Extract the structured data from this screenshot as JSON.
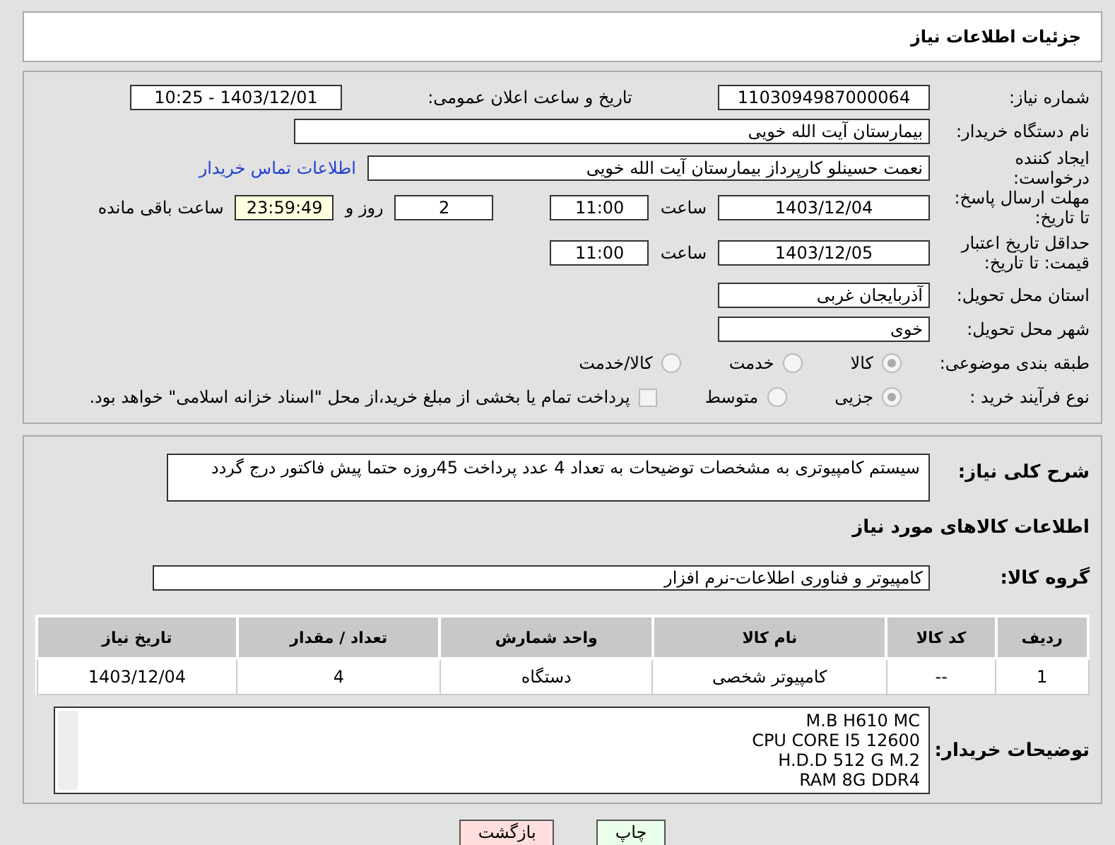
{
  "header": {
    "title": "جزئیات اطلاعات نیاز"
  },
  "need_number": {
    "label": "شماره نیاز:",
    "value": "1103094987000064"
  },
  "announce": {
    "label": "تاریخ و ساعت اعلان عمومی:",
    "value": "1403/12/01 - 10:25"
  },
  "buyer": {
    "label": "نام دستگاه خریدار:",
    "value": "بیمارستان آیت الله خویی"
  },
  "creator": {
    "label": "ایجاد کننده درخواست:",
    "value": "نعمت حسینلو کارپرداز بیمارستان آیت الله خویی",
    "link": "اطلاعات تماس خریدار"
  },
  "deadline": {
    "label": "مهلت ارسال پاسخ: تا تاریخ:",
    "date": "1403/12/04",
    "time_label": "ساعت",
    "time": "11:00",
    "days": "2",
    "days_label": "روز و",
    "remaining": "23:59:49",
    "remaining_label": "ساعت باقی مانده"
  },
  "validity": {
    "label": "حداقل تاریخ اعتبار قیمت: تا تاریخ:",
    "date": "1403/12/05",
    "time_label": "ساعت",
    "time": "11:00"
  },
  "province": {
    "label": "استان محل تحویل:",
    "value": "آذربایجان غربی"
  },
  "city": {
    "label": "شهر محل تحویل:",
    "value": "خوی"
  },
  "category": {
    "label": "طبقه بندی موضوعی:",
    "options": [
      {
        "label": "کالا",
        "selected": true
      },
      {
        "label": "خدمت",
        "selected": false
      },
      {
        "label": "کالا/خدمت",
        "selected": false
      }
    ]
  },
  "process": {
    "label": "نوع فرآیند خرید :",
    "options": [
      {
        "label": "جزیی",
        "selected": true
      },
      {
        "label": "متوسط",
        "selected": false
      }
    ],
    "payment": {
      "label": "پرداخت تمام یا بخشی از مبلغ خرید،از محل \"اسناد خزانه اسلامی\" خواهد بود.",
      "checked": false
    }
  },
  "description": {
    "label": "شرح کلی نیاز:",
    "value": "سیستم کامپیوتری به مشخصات توضیحات به تعداد 4 عدد پرداخت 45روزه حتما پیش فاکتور درج گردد"
  },
  "goods_title": "اطلاعات کالاهای مورد نیاز",
  "goods_group": {
    "label": "گروه کالا:",
    "value": "کامپیوتر و فناوری اطلاعات-نرم افزار"
  },
  "table": {
    "columns": [
      "ردیف",
      "کد کالا",
      "نام کالا",
      "واحد شمارش",
      "تعداد / مقدار",
      "تاریخ نیاز"
    ],
    "rows": [
      [
        "1",
        "--",
        "کامپیوتر شخصی",
        "دستگاه",
        "4",
        "1403/12/04"
      ]
    ]
  },
  "buyer_notes": {
    "label": "توضیحات خریدار:",
    "lines": [
      "M.B H610 MC",
      "CPU CORE I5 12600",
      "H.D.D 512 G M.2",
      "RAM 8G DDR4"
    ]
  },
  "buttons": [
    {
      "label": "چاپ",
      "kind": "print"
    },
    {
      "label": "بازگشت",
      "kind": "back"
    }
  ]
}
